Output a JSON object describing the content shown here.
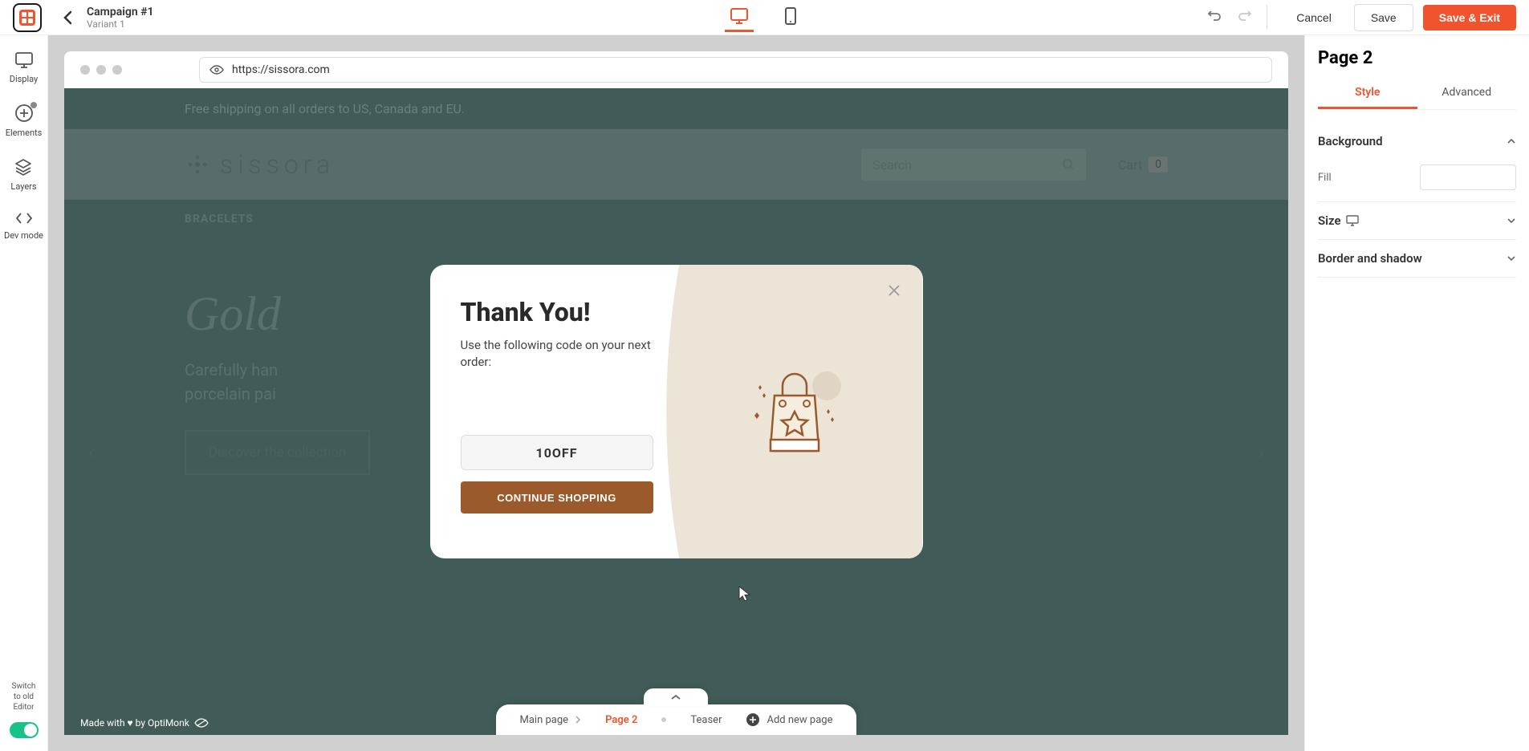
{
  "header": {
    "campaign_title": "Campaign #1",
    "variant": "Variant 1",
    "cancel": "Cancel",
    "save": "Save",
    "save_exit": "Save & Exit"
  },
  "sidebar": {
    "display": "Display",
    "elements": "Elements",
    "layers": "Layers",
    "devmode": "Dev mode",
    "switch": "Switch\nto old\nEditor"
  },
  "browser": {
    "url": "https://sissora.com"
  },
  "site": {
    "banner": "Free shipping on all orders to US, Canada and EU.",
    "brand": "sissora",
    "search_placeholder": "Search",
    "cart_label": "Cart",
    "cart_count": "0",
    "nav1": "BRACELETS",
    "hero_title": "Gold",
    "hero_sub1": "Carefully han",
    "hero_sub2": "porcelain pai",
    "hero_btn": "Discover the collection"
  },
  "popup": {
    "title": "Thank You!",
    "subtitle": "Use the following code on your next order:",
    "code": "10OFF",
    "cta": "CONTINUE SHOPPING"
  },
  "footer": {
    "made_with": "Made with ♥ by OptiMonk"
  },
  "pagenav": {
    "main": "Main page",
    "page2": "Page 2",
    "teaser": "Teaser",
    "add": "Add new page"
  },
  "rightpanel": {
    "title": "Page 2",
    "tab_style": "Style",
    "tab_advanced": "Advanced",
    "background": "Background",
    "fill": "Fill",
    "size": "Size",
    "border": "Border and shadow"
  }
}
